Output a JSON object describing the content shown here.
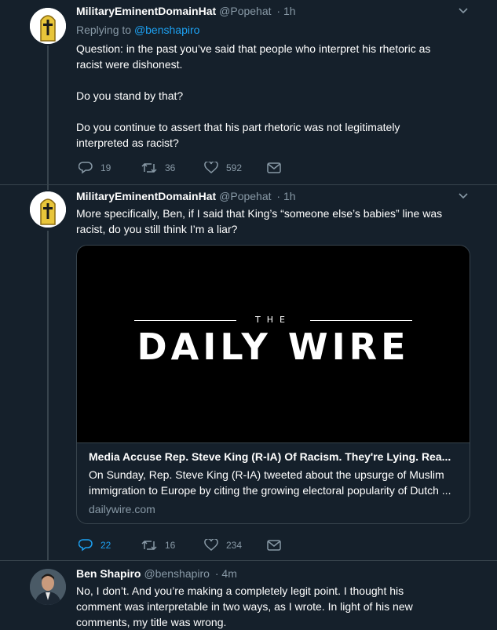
{
  "tweets": [
    {
      "name": "MilitaryEminentDomainHat",
      "handle": "@Popehat",
      "time": "· 1h",
      "replying_prefix": "Replying to ",
      "replying_to": "@benshapiro",
      "paragraphs": [
        "Question:  in the past you’ve said that people who interpret his rhetoric as racist were dishonest.",
        "Do you stand by that?",
        "Do you continue to assert that his part rhetoric was not legitimately interpreted as racist?"
      ],
      "replies": "19",
      "retweets": "36",
      "likes": "592"
    },
    {
      "name": "MilitaryEminentDomainHat",
      "handle": "@Popehat",
      "time": "· 1h",
      "paragraphs": [
        "More specifically, Ben, if I said that King’s “someone else’s babies” line was racist, do you still think I’m a liar?"
      ],
      "card": {
        "image_the": "THE",
        "image_title": "DAILY WIRE",
        "title": "Media Accuse Rep. Steve King (R-IA) Of Racism. They're Lying. Rea...",
        "description": "On Sunday, Rep. Steve King (R-IA) tweeted about the upsurge of Muslim immigration to Europe by citing the growing electoral popularity of Dutch ...",
        "domain": "dailywire.com"
      },
      "replies": "22",
      "retweets": "16",
      "likes": "234"
    },
    {
      "name": "Ben Shapiro",
      "handle": "@benshapiro",
      "time": "· 4m",
      "paragraphs": [
        "No, I don’t. And you’re making a completely legit point. I thought his comment was interpretable in two ways, as I wrote. In light of his new comments, my title was wrong."
      ]
    }
  ],
  "colors": {
    "background": "#15202b",
    "secondary_text": "#8899a6",
    "link": "#1da1f2",
    "border": "#38444d"
  },
  "icons": [
    "popehat-avatar",
    "ben-shapiro-avatar",
    "reply-icon",
    "retweet-icon",
    "like-icon",
    "message-icon",
    "chevron-down-icon"
  ]
}
